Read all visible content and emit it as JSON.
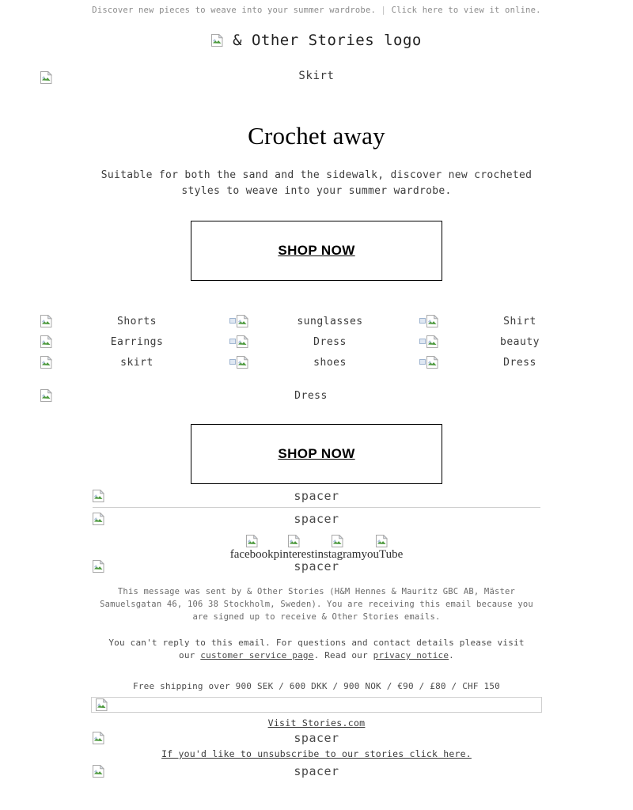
{
  "preheader": {
    "text": "Discover new pieces to weave into your summer wardrobe.",
    "separator": "|",
    "view_online": "Click here to view it online."
  },
  "logo": {
    "alt": "& Other Stories logo",
    "icon": "broken-image-icon"
  },
  "hero": {
    "image_alt": "Skirt",
    "left_image_icon": "broken-image-icon",
    "headline": "Crochet away",
    "subcopy": "Suitable for both the sand and the sidewalk, discover new crocheted styles to weave into your summer wardrobe.",
    "cta_label": "SHOP NOW"
  },
  "grid": {
    "rows": [
      [
        {
          "alt": "Shorts",
          "icon": "broken-image-icon"
        },
        {
          "alt": "sunglasses",
          "icon": "broken-image-linked-icon"
        },
        {
          "alt": "Shirt",
          "icon": "broken-image-linked-icon"
        }
      ],
      [
        {
          "alt": "Earrings",
          "icon": "broken-image-icon"
        },
        {
          "alt": "Dress",
          "icon": "broken-image-linked-icon"
        },
        {
          "alt": "beauty",
          "icon": "broken-image-linked-icon"
        }
      ],
      [
        {
          "alt": "skirt",
          "icon": "broken-image-icon"
        },
        {
          "alt": "shoes",
          "icon": "broken-image-linked-icon"
        },
        {
          "alt": "Dress",
          "icon": "broken-image-linked-icon"
        }
      ]
    ],
    "last_row": {
      "alt": "Dress",
      "icon": "broken-image-icon"
    }
  },
  "cta2_label": "SHOP NOW",
  "spacers": {
    "label": "spacer",
    "icon": "broken-image-icon"
  },
  "social": {
    "items": [
      {
        "label": "facebook",
        "icon": "broken-image-icon"
      },
      {
        "label": "pinterest",
        "icon": "broken-image-icon"
      },
      {
        "label": "instagram",
        "icon": "broken-image-icon"
      },
      {
        "label": "youTube",
        "icon": "broken-image-icon"
      }
    ]
  },
  "footer": {
    "legal": "This message was sent by & Other Stories (H&M Hennes & Mauritz GBC AB, Mäster Samuelsgatan 46, 106 38 Stockholm, Sweden). You are receiving this email because you are signed up to receive & Other Stories emails.",
    "reply_text_before": "You can't reply to this email. For questions and contact details please visit our ",
    "customer_service_link": "customer service page",
    "reply_text_middle": ". Read our ",
    "privacy_link": "privacy notice",
    "reply_text_end": ".",
    "shipping": "Free shipping over 900 SEK / 600 DKK / 900 NOK / €90 / £80 / CHF 150",
    "banner_icon": "broken-image-icon",
    "visit_link": "Visit Stories.com",
    "unsubscribe_link": "If you'd like to unsubscribe to our stories click here."
  },
  "colors": {
    "background": "#ffffff",
    "text": "#000000",
    "muted_text": "#6a6a6a",
    "preheader_text": "#8a8a8a",
    "border": "#000000",
    "divider": "#cfcfcf",
    "icon_green": "#4e9a3e",
    "icon_blue": "#b3c6de"
  }
}
